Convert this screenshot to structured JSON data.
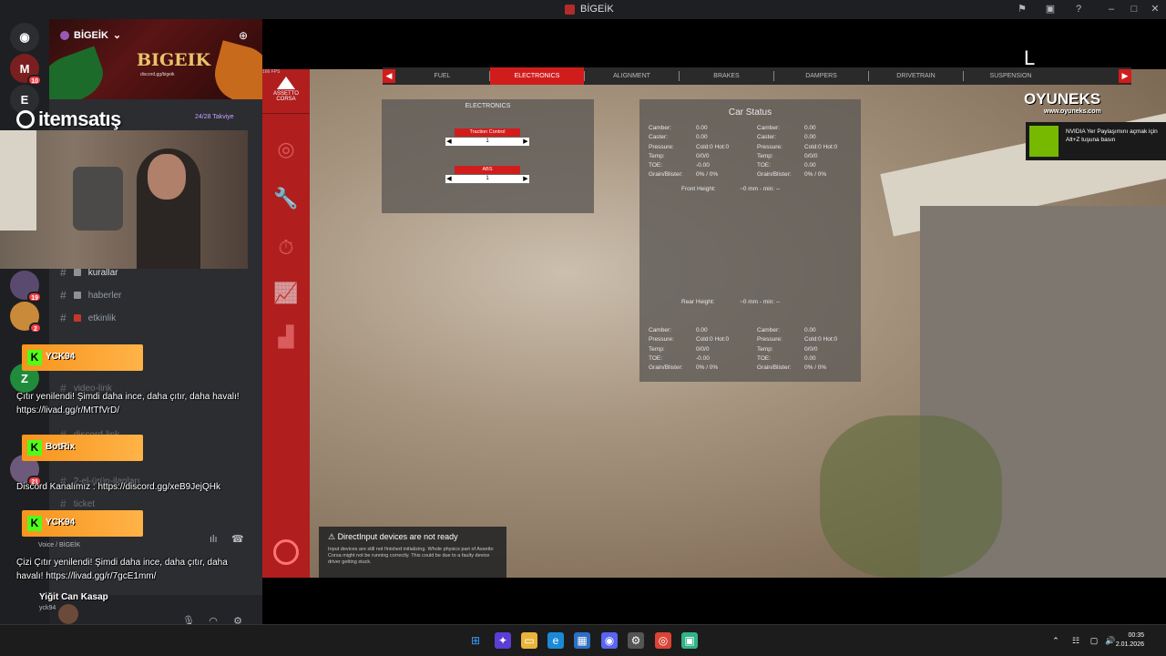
{
  "window": {
    "title": "BİGEİK",
    "controls": [
      "pin-icon",
      "minimize-icon",
      "maximize-icon",
      "close-icon"
    ]
  },
  "rail": {
    "servers": [
      {
        "icon": "discord-icon",
        "letter": "",
        "badge": ""
      },
      {
        "icon": "server-m-icon",
        "letter": "M",
        "badge": "10"
      },
      {
        "icon": "server-e-icon",
        "letter": "E",
        "badge": "1"
      },
      {
        "icon": "server-avatar-icon",
        "letter": "",
        "badge": "19"
      },
      {
        "icon": "server-avatar-icon",
        "letter": "",
        "badge": "2"
      },
      {
        "icon": "server-z-icon",
        "letter": "Z",
        "badge": ""
      },
      {
        "icon": "server-avatar-icon",
        "letter": "",
        "badge": "21"
      }
    ]
  },
  "server": {
    "name": "BİGEİK",
    "banner_logo": "BIGEIK",
    "banner_sub": "discord.gg/bigeik",
    "boost": "24/28 Takviye"
  },
  "channels": [
    {
      "name": "kurallar",
      "style": "bright"
    },
    {
      "name": "haberler",
      "style": "normal"
    },
    {
      "name": "etkinlik",
      "style": "normal"
    },
    {
      "name": "video-link",
      "style": "dim"
    },
    {
      "name": "discord-link",
      "style": "dim"
    },
    {
      "name": "2-el-ürün-ilanları",
      "style": "dim"
    },
    {
      "name": "ticket",
      "style": "dim"
    }
  ],
  "voice": {
    "label": "Voice / BİGEİK"
  },
  "user": {
    "name": "Yiğit Can Kasap",
    "tag": "yck94"
  },
  "overlay": {
    "brand": "itemsatış",
    "alerts": [
      "YCK94",
      "BotRix",
      "YCK94"
    ],
    "chat": [
      "Çıtır yenilendi! Şimdi daha ince, daha çıtır, daha havalı! https://livad.gg/r/MtTfVrD/",
      "Discord Kanalımız : https://discord.gg/xeB9JejQHk",
      "Çizi Çıtır yenilendi! Şimdi daha ince, daha çıtır, daha havalı! https://livad.gg/r/7gcE1mm/"
    ]
  },
  "game": {
    "brand": "ASSETTO CORSA",
    "fps": "166 FPS",
    "tabs": [
      "FUEL",
      "ELECTRONICS",
      "ALIGNMENT",
      "BRAKES",
      "DAMPERS",
      "DRIVETRAIN",
      "SUSPENSION"
    ],
    "active_tab": "ELECTRONICS",
    "electronics": {
      "title": "ELECTRONICS",
      "controls": [
        {
          "label": "Traction Control",
          "value": "1"
        },
        {
          "label": "ABS",
          "value": "1"
        }
      ]
    },
    "car_status": {
      "title": "Car Status",
      "front": [
        [
          [
            "Camber:",
            "0.00"
          ],
          [
            "Caster:",
            "0.00"
          ],
          [
            "Pressure:",
            "Cold:0 Hot:0"
          ],
          [
            "Temp:",
            "0/0/0"
          ],
          [
            "TOE:",
            "-0.00"
          ],
          [
            "Grain/Blister:",
            "0% / 0%"
          ]
        ],
        [
          [
            "Camber:",
            "0.00"
          ],
          [
            "Caster:",
            "0.00"
          ],
          [
            "Pressure:",
            "Cold:0 Hot:0"
          ],
          [
            "Temp:",
            "0/0/0"
          ],
          [
            "TOE:",
            "0.00"
          ],
          [
            "Grain/Blister:",
            "0% / 0%"
          ]
        ]
      ],
      "front_height": "Front Height:",
      "front_height_val": "~0 mm - min: --",
      "rear_height": "Rear Height:",
      "rear_height_val": "~0 mm - min: --",
      "rear": [
        [
          [
            "Camber:",
            "0.00"
          ],
          [
            "Pressure:",
            "Cold:0 Hot:0"
          ],
          [
            "Temp:",
            "0/0/0"
          ],
          [
            "TOE:",
            "-0.00"
          ],
          [
            "Grain/Blister:",
            "0% / 0%"
          ]
        ],
        [
          [
            "Camber:",
            "0.00"
          ],
          [
            "Pressure:",
            "Cold:0 Hot:0"
          ],
          [
            "Temp:",
            "0/0/0"
          ],
          [
            "TOE:",
            "0.00"
          ],
          [
            "Grain/Blister:",
            "0% / 0%"
          ]
        ]
      ]
    },
    "warning": {
      "title": "DirectInput devices are not ready",
      "detail": "Input devices are still not finished initializing. Whole physics part of Assetto Corsa might not be running correctly. This could be due to a faulty device driver getting stuck."
    },
    "oyuneks": {
      "name": "OYUNEKS",
      "url": "www.oyuneks.com"
    },
    "nvidia": "NVIDIA Yer Paylaşımını açmak için Alt+Z tuşuna basın",
    "corner_mark": "L"
  },
  "taskbar": {
    "time": "00:35",
    "date": "2.01.2026",
    "apps": [
      "windows-icon",
      "copilot-icon",
      "folder-icon",
      "edge-icon",
      "store-icon",
      "discord-icon",
      "settings-icon",
      "chrome-icon",
      "app-icon"
    ]
  }
}
